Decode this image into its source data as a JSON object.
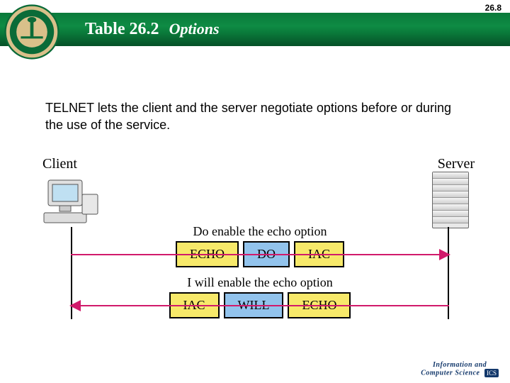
{
  "page_number": "26.8",
  "title": {
    "table_ref": "Table 26.2",
    "subtitle": "Options"
  },
  "body": "TELNET lets the client and the server negotiate options before or during the use of the service.",
  "diagram": {
    "client_label": "Client",
    "server_label": "Server",
    "row1": {
      "direction": "right",
      "label": "Do enable the echo option",
      "boxes": [
        {
          "text": "ECHO",
          "style": "yellow"
        },
        {
          "text": "DO",
          "style": "blue"
        },
        {
          "text": "IAC",
          "style": "yellow"
        }
      ]
    },
    "row2": {
      "direction": "left",
      "label": "I will enable the echo option",
      "boxes": [
        {
          "text": "IAC",
          "style": "yellow"
        },
        {
          "text": "WILL",
          "style": "blue"
        },
        {
          "text": "ECHO",
          "style": "yellow"
        }
      ]
    }
  },
  "footer": {
    "line1": "Information and",
    "line2": "Computer Science",
    "badge": "ICS"
  }
}
